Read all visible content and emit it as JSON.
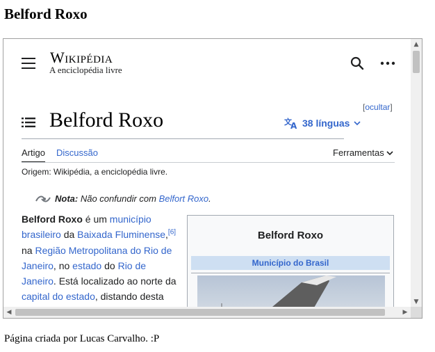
{
  "page": {
    "heading": "Belford Roxo",
    "footer": "Página criada por Lucas Carvalho. :P"
  },
  "wiki": {
    "wordmark": "Wikipédia",
    "tagline": "A enciclopédia livre",
    "hide_label": "ocultar",
    "title": "Belford Roxo",
    "languages_label": "38 línguas",
    "tabs": [
      {
        "label": "Artigo",
        "active": true
      },
      {
        "label": "Discussão",
        "active": false
      }
    ],
    "tools_label": "Ferramentas",
    "origin": "Origem: Wikipédia, a enciclopédia livre.",
    "hatnote": {
      "label": "Nota:",
      "text": "Não confundir com",
      "link": "Belfort Roxo",
      "end": "."
    },
    "body": {
      "bold_name": "Belford Roxo",
      "t1": " é um ",
      "l_municipio": "município brasileiro",
      "t2": " da ",
      "l_baixada": "Baixada Fluminense",
      "t3": ",",
      "ref": "[6]",
      "t4": " na ",
      "l_regiao": "Região Metropolitana do Rio de Janeiro",
      "t5": ", no ",
      "l_estado": "estado",
      "t6": " do ",
      "l_rio": "Rio de Janeiro",
      "t7": ". Está localizado ao norte da ",
      "l_capital": "capital do estado",
      "t8": ", distando desta"
    },
    "infobox": {
      "title": "Belford Roxo",
      "subtitle": "Município do Brasil"
    }
  },
  "colors": {
    "link": "#3366cc",
    "text": "#202122",
    "infobox_header": "#cedff2"
  }
}
